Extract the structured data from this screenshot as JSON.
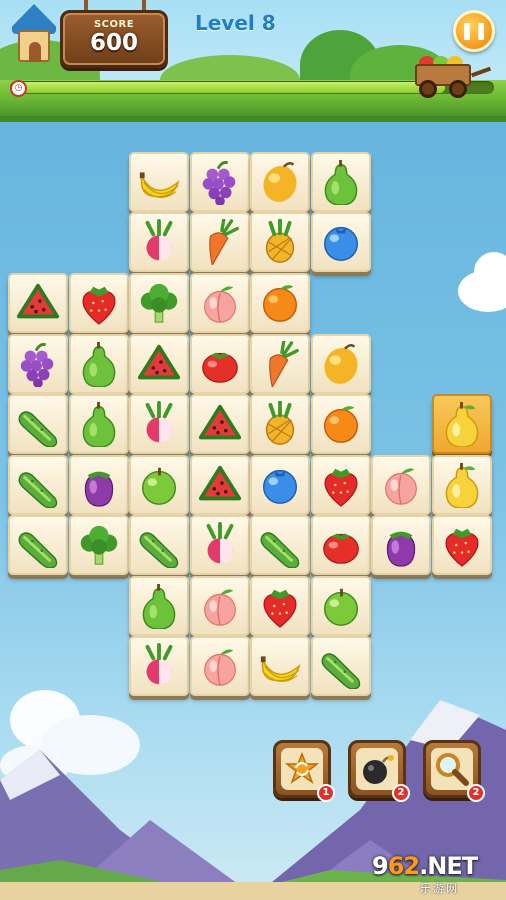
{
  "header": {
    "score_label": "SCORE",
    "score_value": "600",
    "level": "Level 8",
    "pause_icon": "pause-icon",
    "progress": 0.9
  },
  "colors": {
    "tile_face": "#fff9e8",
    "tile_selected": "#f0a830",
    "sky": "#7cc3e6",
    "grass": "#6cb733"
  },
  "tiles": [
    {
      "fruit": "banana",
      "selected": false
    },
    {
      "fruit": "grapes",
      "selected": false
    },
    {
      "fruit": "mango",
      "selected": false
    },
    {
      "fruit": "pear",
      "selected": false
    },
    {
      "fruit": "radish",
      "selected": false
    },
    {
      "fruit": "carrot",
      "selected": false
    },
    {
      "fruit": "pineapple",
      "selected": false
    },
    {
      "fruit": "blueberry",
      "selected": false
    },
    {
      "fruit": "watermelon",
      "selected": false
    },
    {
      "fruit": "strawberry",
      "selected": false
    },
    {
      "fruit": "broccoli",
      "selected": false
    },
    {
      "fruit": "peach",
      "selected": false
    },
    {
      "fruit": "orange",
      "selected": false
    },
    {
      "fruit": "grapes",
      "selected": false
    },
    {
      "fruit": "pear",
      "selected": false
    },
    {
      "fruit": "watermelon",
      "selected": false
    },
    {
      "fruit": "tomato",
      "selected": false
    },
    {
      "fruit": "carrot",
      "selected": false
    },
    {
      "fruit": "mango",
      "selected": false
    },
    {
      "fruit": "cucumber",
      "selected": false
    },
    {
      "fruit": "pear",
      "selected": false
    },
    {
      "fruit": "radish",
      "selected": false
    },
    {
      "fruit": "watermelon",
      "selected": false
    },
    {
      "fruit": "pineapple",
      "selected": false
    },
    {
      "fruit": "orange",
      "selected": false
    },
    {
      "fruit": "yellow-pear",
      "selected": true
    },
    {
      "fruit": "cucumber",
      "selected": false
    },
    {
      "fruit": "eggplant",
      "selected": false
    },
    {
      "fruit": "apple",
      "selected": false
    },
    {
      "fruit": "watermelon",
      "selected": false
    },
    {
      "fruit": "blueberry",
      "selected": false
    },
    {
      "fruit": "strawberry",
      "selected": false
    },
    {
      "fruit": "peach",
      "selected": false
    },
    {
      "fruit": "yellow-pear",
      "selected": false
    },
    {
      "fruit": "cucumber",
      "selected": false
    },
    {
      "fruit": "broccoli",
      "selected": false
    },
    {
      "fruit": "cucumber",
      "selected": false
    },
    {
      "fruit": "radish",
      "selected": false
    },
    {
      "fruit": "cucumber",
      "selected": false
    },
    {
      "fruit": "tomato",
      "selected": false
    },
    {
      "fruit": "eggplant",
      "selected": false
    },
    {
      "fruit": "strawberry",
      "selected": false
    },
    {
      "fruit": "pear",
      "selected": false
    },
    {
      "fruit": "peach",
      "selected": false
    },
    {
      "fruit": "strawberry",
      "selected": false
    },
    {
      "fruit": "apple",
      "selected": false
    },
    {
      "fruit": "radish",
      "selected": false
    },
    {
      "fruit": "peach",
      "selected": false
    },
    {
      "fruit": "banana",
      "selected": false
    },
    {
      "fruit": "cucumber",
      "selected": false
    }
  ],
  "powerups": [
    {
      "name": "shuffle",
      "icon": "shuffle-icon",
      "count": "1"
    },
    {
      "name": "bomb",
      "icon": "bomb-icon",
      "count": "2"
    },
    {
      "name": "hint",
      "icon": "magnifier-icon",
      "count": "2"
    }
  ],
  "watermark": {
    "prefix": "9",
    "num": "62",
    "suffix": ".NET",
    "sub": "乐游网"
  }
}
